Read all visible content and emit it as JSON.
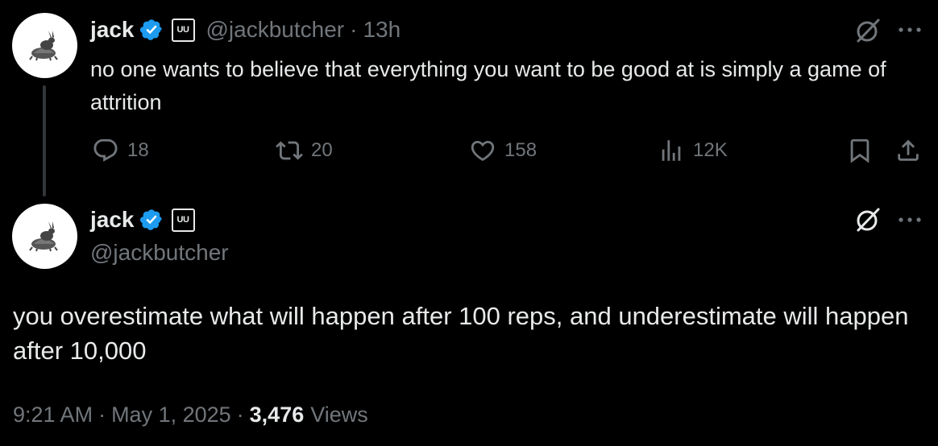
{
  "reply_tweet": {
    "author_name": "jack",
    "affiliate_badge": "UU",
    "handle": "@jackbutcher",
    "separator": "·",
    "time": "13h",
    "text": "no one wants to believe that everything you want to be good at is simply a game of attrition",
    "replies": "18",
    "reposts": "20",
    "likes": "158",
    "views": "12K"
  },
  "main_tweet": {
    "author_name": "jack",
    "affiliate_badge": "UU",
    "handle": "@jackbutcher",
    "text": "you overestimate what will happen after 100 reps, and underestimate will happen after 10,000",
    "time": "9:21 AM",
    "separator": "·",
    "date": "May 1, 2025",
    "views_count": "3,476",
    "views_label": "Views"
  },
  "colors": {
    "background": "#000000",
    "primary_text": "#e7e9ea",
    "secondary_text": "#71767b",
    "verified_blue": "#1d9bf0",
    "thread_line": "#333639"
  }
}
